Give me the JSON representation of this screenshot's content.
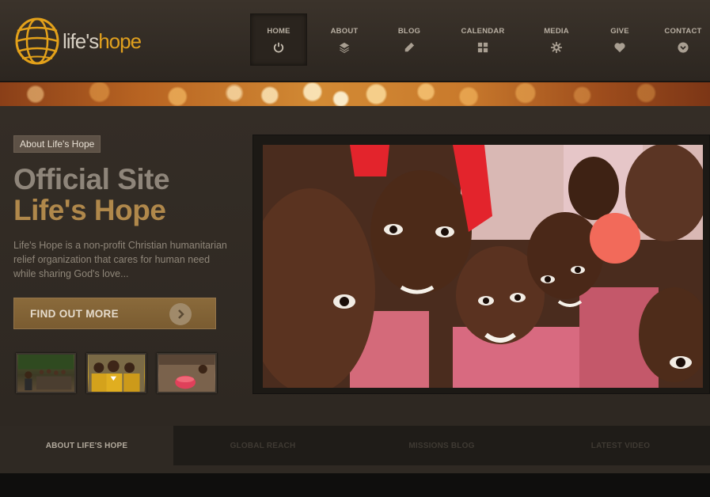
{
  "logo": {
    "text_life": "life's",
    "text_hope": "hope"
  },
  "nav": [
    {
      "label": "HOME",
      "icon": "power-icon",
      "active": true
    },
    {
      "label": "ABOUT",
      "icon": "layers-icon"
    },
    {
      "label": "BLOG",
      "icon": "pencil-icon"
    },
    {
      "label": "CALENDAR",
      "icon": "grid-icon"
    },
    {
      "label": "MEDIA",
      "icon": "gear-icon"
    },
    {
      "label": "GIVE",
      "icon": "heart-icon"
    },
    {
      "label": "CONTACT",
      "icon": "chevron-down-circle-icon"
    }
  ],
  "hero": {
    "tag": "About Life's Hope",
    "headline_1": "Official Site",
    "headline_2": "Life's Hope",
    "description": "Life's Hope is a non-profit Christian humanitarian relief organization that cares for human need while sharing God's love...",
    "button_label": "FIND OUT MORE"
  },
  "tabs": [
    {
      "label": "ABOUT LIFE'S HOPE",
      "active": true
    },
    {
      "label": "GLOBAL REACH"
    },
    {
      "label": "MISSIONS BLOG"
    },
    {
      "label": "LATEST VIDEO"
    }
  ],
  "colors": {
    "accent_gold": "#e0a01e",
    "headline_gold": "#b0884b",
    "button": "#7a5c31",
    "background": "#2e2822"
  }
}
